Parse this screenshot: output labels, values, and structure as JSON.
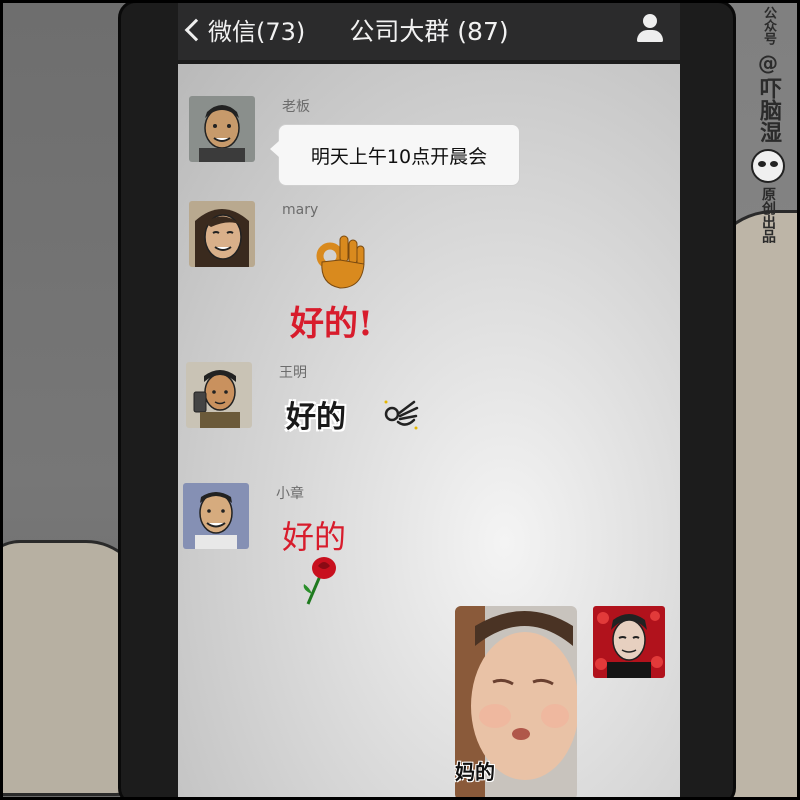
{
  "navbar": {
    "back_label": "微信(73)",
    "title": "公司大群 (87)",
    "profile_icon": "person-icon"
  },
  "messages": [
    {
      "sender": "老板",
      "type": "text",
      "text": "明天上午10点开晨会"
    },
    {
      "sender": "mary",
      "type": "sticker",
      "sticker_icon": "ok-hand-icon",
      "sticker_text": "好的!"
    },
    {
      "sender": "王明",
      "type": "sticker",
      "sticker_icon": "ok-hand-icon",
      "sticker_text": "好的"
    },
    {
      "sender": "小章",
      "type": "sticker",
      "sticker_icon": "rose-icon",
      "sticker_text": "好的"
    },
    {
      "sender": "",
      "type": "image",
      "caption": "妈的",
      "self": true
    }
  ],
  "watermark": {
    "label_small": "公众号",
    "at": "@",
    "name": "吓脑湿",
    "label_bottom": "原创出品"
  },
  "colors": {
    "navbar": "#2b2b2c",
    "sticker_red": "#d81c2c",
    "ok_hand": "#d98a1e"
  }
}
